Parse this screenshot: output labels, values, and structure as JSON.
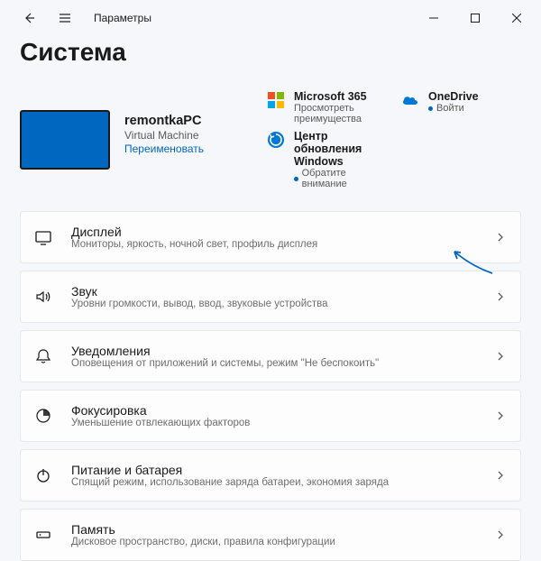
{
  "titlebar": {
    "title": "Параметры"
  },
  "page": {
    "heading": "Система"
  },
  "pc": {
    "name": "remontkaPC",
    "type": "Virtual Machine",
    "rename": "Переименовать"
  },
  "tiles": {
    "ms365": {
      "title": "Microsoft 365",
      "sub": "Просмотреть преимущества"
    },
    "onedrive": {
      "title": "OneDrive",
      "status": "Войти"
    },
    "update": {
      "title": "Центр обновления Windows",
      "status": "Обратите внимание"
    }
  },
  "list": [
    {
      "id": "display",
      "title": "Дисплей",
      "sub": "Мониторы, яркость, ночной свет, профиль дисплея"
    },
    {
      "id": "sound",
      "title": "Звук",
      "sub": "Уровни громкости, вывод, ввод, звуковые устройства"
    },
    {
      "id": "notifications",
      "title": "Уведомления",
      "sub": "Оповещения от приложений и системы, режим \"Не беспокоить\""
    },
    {
      "id": "focus",
      "title": "Фокусировка",
      "sub": "Уменьшение отвлекающих факторов"
    },
    {
      "id": "power",
      "title": "Питание и батарея",
      "sub": "Спящий режим, использование заряда батареи, экономия заряда"
    },
    {
      "id": "storage",
      "title": "Память",
      "sub": "Дисковое пространство, диски, правила конфигурации"
    }
  ]
}
